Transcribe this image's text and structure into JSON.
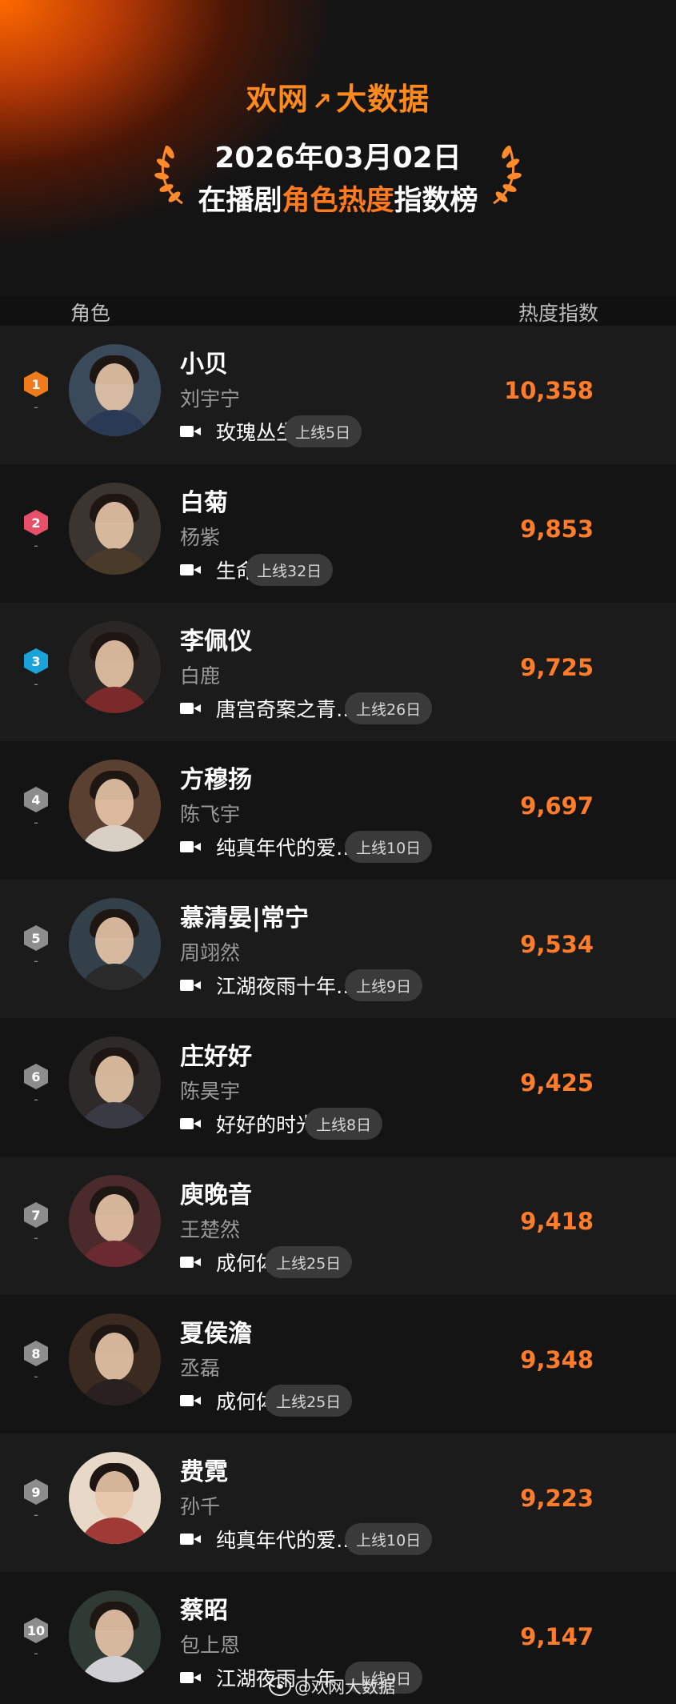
{
  "header": {
    "brand_left": "欢网",
    "brand_arrow": "↗",
    "brand_right": "大数据",
    "date": "2026年03月02日",
    "title_pre": "在播剧",
    "title_highlight": "角色热度",
    "title_post": "指数榜"
  },
  "columns": {
    "role": "角色",
    "index": "热度指数"
  },
  "colors": {
    "accent": "#ff7d2a",
    "rank1": "#f07b1d",
    "rank2": "#e8506a",
    "rank3": "#1aa3d8",
    "rank_other": "#8d8d8d"
  },
  "entries": [
    {
      "rank": "1",
      "trend": "-",
      "name": "小贝",
      "actor": "刘宇宁",
      "show": "玫瑰丛生",
      "online": "上线5日",
      "score": "10,358"
    },
    {
      "rank": "2",
      "trend": "-",
      "name": "白菊",
      "actor": "杨紫",
      "show": "生命树",
      "online": "上线32日",
      "score": "9,853"
    },
    {
      "rank": "3",
      "trend": "-",
      "name": "李佩仪",
      "actor": "白鹿",
      "show": "唐宫奇案之青…",
      "online": "上线26日",
      "score": "9,725"
    },
    {
      "rank": "4",
      "trend": "-",
      "name": "方穆扬",
      "actor": "陈飞宇",
      "show": "纯真年代的爱…",
      "online": "上线10日",
      "score": "9,697"
    },
    {
      "rank": "5",
      "trend": "-",
      "name": "慕清晏|常宁",
      "actor": "周翊然",
      "show": "江湖夜雨十年…",
      "online": "上线9日",
      "score": "9,534"
    },
    {
      "rank": "6",
      "trend": "-",
      "name": "庄好好",
      "actor": "陈昊宇",
      "show": "好好的时光",
      "online": "上线8日",
      "score": "9,425"
    },
    {
      "rank": "7",
      "trend": "-",
      "name": "庾晚音",
      "actor": "王楚然",
      "show": "成何体统",
      "online": "上线25日",
      "score": "9,418"
    },
    {
      "rank": "8",
      "trend": "-",
      "name": "夏侯澹",
      "actor": "丞磊",
      "show": "成何体统",
      "online": "上线25日",
      "score": "9,348"
    },
    {
      "rank": "9",
      "trend": "-",
      "name": "费霓",
      "actor": "孙千",
      "show": "纯真年代的爱…",
      "online": "上线10日",
      "score": "9,223"
    },
    {
      "rank": "10",
      "trend": "-",
      "name": "蔡昭",
      "actor": "包上恩",
      "show": "江湖夜雨十年",
      "online": "上线9日",
      "score": "9,147"
    }
  ],
  "watermark": "@欢网大数据"
}
